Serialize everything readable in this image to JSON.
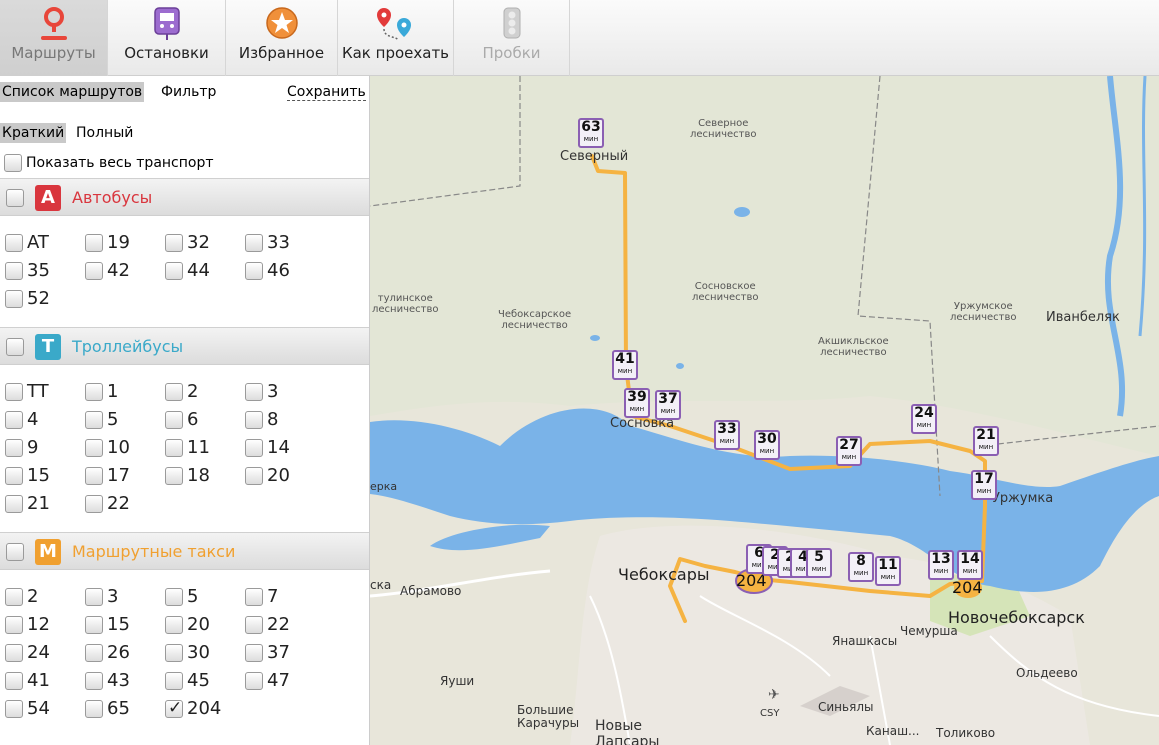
{
  "toolbar": {
    "routes": "Маршруты",
    "stops": "Остановки",
    "favorites": "Избранное",
    "directions": "Как проехать",
    "traffic": "Пробки"
  },
  "sidebar": {
    "route_list": "Список маршрутов",
    "filter": "Фильтр",
    "save": "Сохранить",
    "short": "Краткий",
    "full": "Полный",
    "show_all": "Показать весь транспорт",
    "buses": {
      "badge": "A",
      "title": "Автобусы",
      "color": "#d9363e",
      "routes": [
        "AT",
        "19",
        "32",
        "33",
        "35",
        "42",
        "44",
        "46",
        "52"
      ]
    },
    "trolleys": {
      "badge": "T",
      "title": "Троллейбусы",
      "color": "#3aa9c9",
      "routes": [
        "TT",
        "1",
        "2",
        "3",
        "4",
        "5",
        "6",
        "8",
        "9",
        "10",
        "11",
        "14",
        "15",
        "17",
        "18",
        "20",
        "21",
        "22"
      ]
    },
    "taxis": {
      "badge": "M",
      "title": "Маршрутные такси",
      "color": "#f0a030",
      "routes": [
        "2",
        "3",
        "5",
        "7",
        "12",
        "15",
        "20",
        "22",
        "24",
        "26",
        "30",
        "37",
        "41",
        "43",
        "45",
        "47",
        "54",
        "65",
        "204"
      ],
      "checked": "204"
    }
  },
  "map": {
    "route_color": "#f5b342",
    "route_label": "204",
    "unit": "мин",
    "stops": [
      "63",
      "41",
      "39",
      "37",
      "33",
      "30",
      "27",
      "24",
      "21",
      "17",
      "6",
      "2",
      "2",
      "4",
      "5",
      "8",
      "11",
      "13",
      "14"
    ],
    "labels": {
      "severny": "Северный",
      "severnoe": "Северное\nлесничество",
      "sosnovskoe": "Сосновское\nлесничество",
      "cheboksarskoe": "Чебоксарское\nлесничество",
      "tulinskoe": "тулинское\nлесничество",
      "akshuyk": "Акшикльское\nлесничество",
      "urzhumskoe": "Уржумское\nлесничество",
      "ivanbelyak": "Иванбеляк",
      "sosnovka": "Сосновка",
      "urzhumka": "Уржумка",
      "cheboksary": "Чебоксары",
      "novocheboksarsk": "Новочебоксарск",
      "yanashkasy": "Янашкасы",
      "chemursha": "Чемурша",
      "oldeevo": "Ольдеево",
      "sinyaly": "Синьялы",
      "yashi": "Яуши",
      "karachury": "Большие\nКарачуры",
      "novye": "Новые\nЛапсары",
      "tolikovo": "Толиково",
      "kanashi": "Канаш...",
      "csy": "CSY",
      "ska": "ска",
      "rka": "ерка",
      "abramovo": "Абрамово"
    }
  }
}
